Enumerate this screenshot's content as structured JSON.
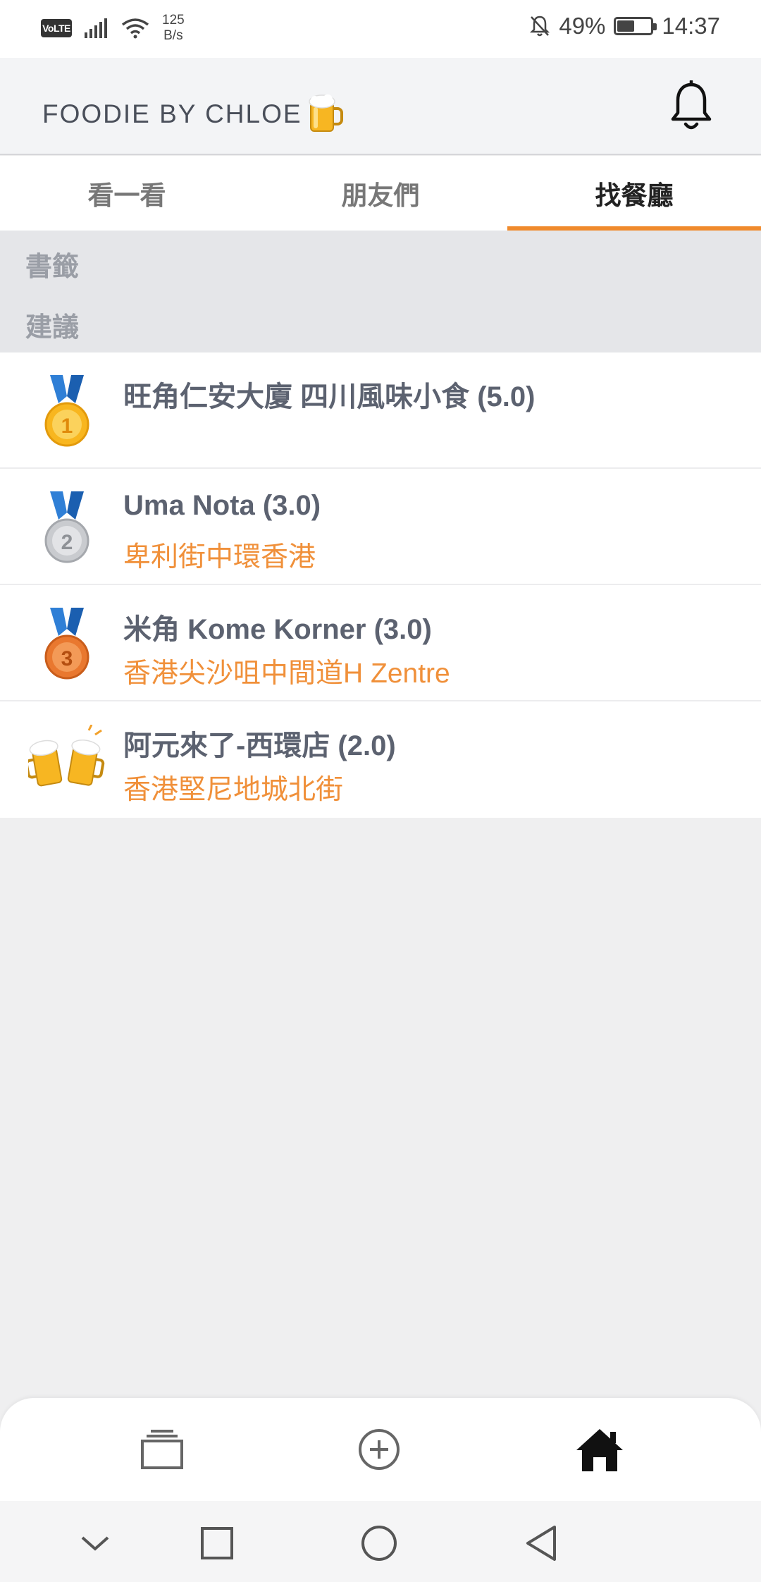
{
  "status_bar": {
    "volte": "VoLTE",
    "net_speed_value": "125",
    "net_speed_unit": "B/s",
    "battery": "49%",
    "time": "14:37"
  },
  "header": {
    "title": "FOODIE BY CHLOE",
    "title_emoji": "beer-mug-icon",
    "bell_icon": "bell-icon"
  },
  "tabs": [
    {
      "label": "看一看",
      "active": false
    },
    {
      "label": "朋友們",
      "active": false
    },
    {
      "label": "找餐廳",
      "active": true
    }
  ],
  "sections": {
    "bookmarks": "書籤",
    "suggestions": "建議"
  },
  "restaurants": [
    {
      "rank_icon": "gold-medal-icon",
      "title": "旺角仁安大廈 四川風味小食 (5.0)",
      "address": ""
    },
    {
      "rank_icon": "silver-medal-icon",
      "title": "Uma Nota (3.0)",
      "address": "卑利街中環香港"
    },
    {
      "rank_icon": "bronze-medal-icon",
      "title": "米角 Kome Korner (3.0)",
      "address": "香港尖沙咀中間道H Zentre"
    },
    {
      "rank_icon": "clinking-beer-mugs-icon",
      "title": "阿元來了-西環店 (2.0)",
      "address": "香港堅尼地城北街"
    }
  ],
  "colors": {
    "accent": "#f08a2c",
    "address": "#f0903a",
    "title_text": "#5c6270"
  }
}
